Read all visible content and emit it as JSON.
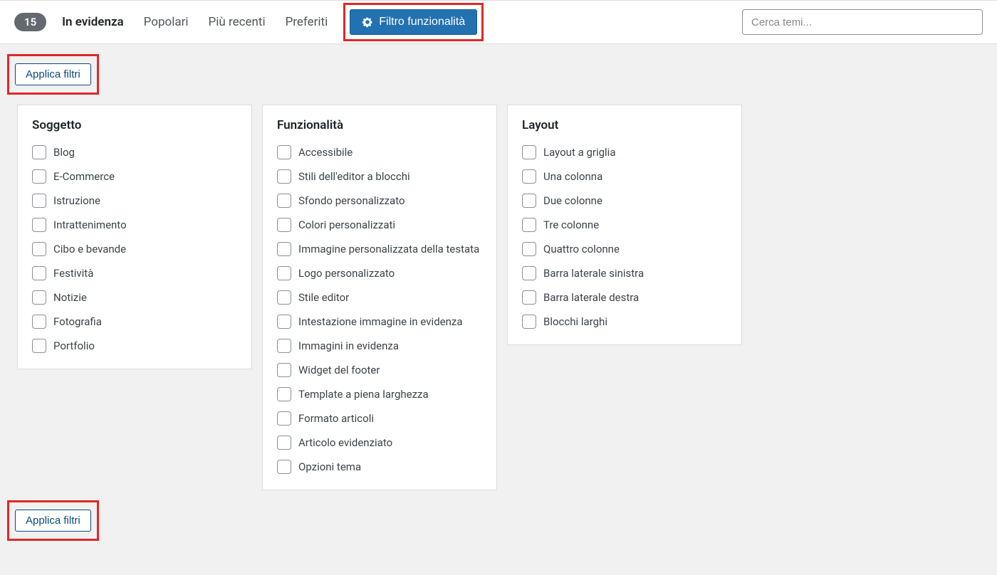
{
  "header": {
    "count": "15",
    "tabs": {
      "featured": "In evidenza",
      "popular": "Popolari",
      "latest": "Più recenti",
      "favorites": "Preferiti"
    },
    "feature_filter_label": "Filtro funzionalità",
    "search_placeholder": "Cerca temi..."
  },
  "apply_filters_label": "Applica filtri",
  "columns": {
    "subject": {
      "title": "Soggetto",
      "items": [
        "Blog",
        "E-Commerce",
        "Istruzione",
        "Intrattenimento",
        "Cibo e bevande",
        "Festività",
        "Notizie",
        "Fotografia",
        "Portfolio"
      ]
    },
    "features": {
      "title": "Funzionalità",
      "items": [
        "Accessibile",
        "Stili dell'editor a blocchi",
        "Sfondo personalizzato",
        "Colori personalizzati",
        "Immagine personalizzata della testata",
        "Logo personalizzato",
        "Stile editor",
        "Intestazione immagine in evidenza",
        "Immagini in evidenza",
        "Widget del footer",
        "Template a piena larghezza",
        "Formato articoli",
        "Articolo evidenziato",
        "Opzioni tema"
      ]
    },
    "layout": {
      "title": "Layout",
      "items": [
        "Layout a griglia",
        "Una colonna",
        "Due colonne",
        "Tre colonne",
        "Quattro colonne",
        "Barra laterale sinistra",
        "Barra laterale destra",
        "Blocchi larghi"
      ]
    }
  }
}
